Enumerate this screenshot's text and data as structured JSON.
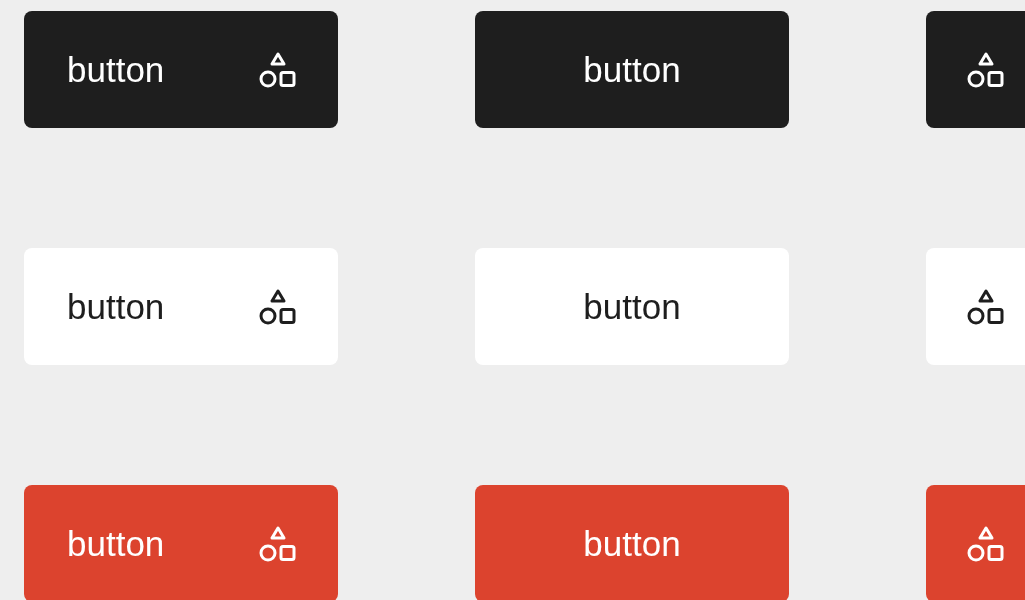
{
  "rows": [
    {
      "kind": "dark",
      "buttons": [
        {
          "kind": "text-icon",
          "label": "button"
        },
        {
          "kind": "text",
          "label": "button"
        },
        {
          "kind": "icon"
        }
      ]
    },
    {
      "kind": "light",
      "buttons": [
        {
          "kind": "text-icon",
          "label": "button"
        },
        {
          "kind": "text",
          "label": "button"
        },
        {
          "kind": "icon"
        }
      ]
    },
    {
      "kind": "red",
      "buttons": [
        {
          "kind": "text-icon",
          "label": "button"
        },
        {
          "kind": "text",
          "label": "button"
        },
        {
          "kind": "icon"
        }
      ]
    }
  ]
}
